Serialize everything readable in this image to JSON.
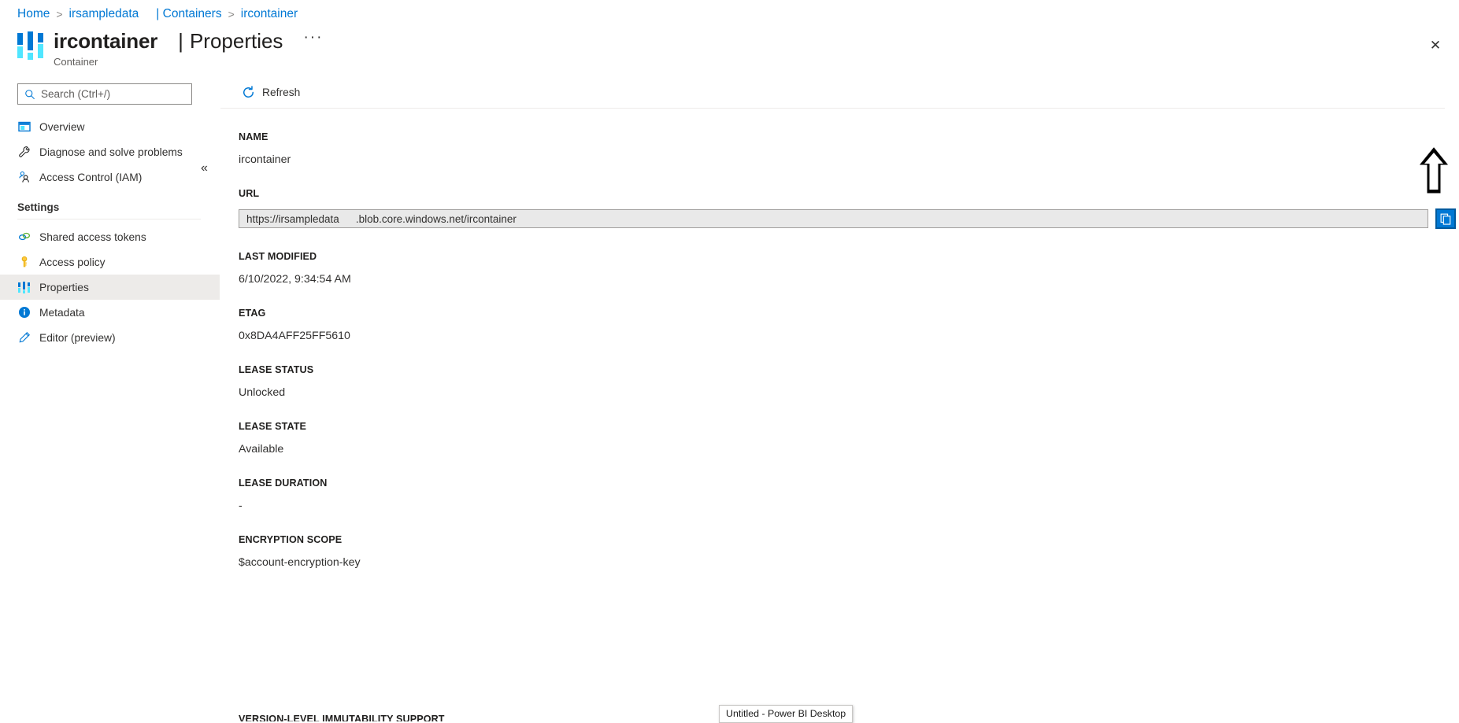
{
  "breadcrumb": {
    "items": [
      {
        "label": "Home"
      },
      {
        "label": "irsampledata"
      },
      {
        "label": "| Containers"
      },
      {
        "label": "ircontainer"
      }
    ],
    "separator": ">"
  },
  "header": {
    "icon": "container-properties-icon",
    "name": "ircontainer",
    "divider": "|",
    "section": "Properties",
    "ellipsis": "···",
    "subtitle": "Container",
    "close_label": "✕"
  },
  "sidebar": {
    "search": {
      "placeholder": "Search (Ctrl+/)",
      "value": "",
      "icon": "search-icon"
    },
    "collapse_label": "«",
    "items": [
      {
        "label": "Overview",
        "icon": "overview-icon",
        "selected": false
      },
      {
        "label": "Diagnose and solve problems",
        "icon": "wrench-icon",
        "selected": false
      },
      {
        "label": "Access Control (IAM)",
        "icon": "people-icon",
        "selected": false
      }
    ],
    "group": {
      "title": "Settings",
      "items": [
        {
          "label": "Shared access tokens",
          "icon": "link-rings-icon",
          "selected": false
        },
        {
          "label": "Access policy",
          "icon": "key-icon",
          "selected": false
        },
        {
          "label": "Properties",
          "icon": "properties-bars-icon",
          "selected": true
        },
        {
          "label": "Metadata",
          "icon": "info-icon",
          "selected": false
        },
        {
          "label": "Editor (preview)",
          "icon": "pencil-icon",
          "selected": false
        }
      ]
    }
  },
  "command_bar": {
    "refresh_label": "Refresh",
    "refresh_icon": "refresh-icon"
  },
  "properties": {
    "name": {
      "label": "NAME",
      "value": "ircontainer"
    },
    "url": {
      "label": "URL",
      "value_prefix": "https://irsampledata",
      "value_suffix": ".blob.core.windows.net/ircontainer",
      "copy_icon": "copy-icon",
      "copy_title": "Copy to clipboard"
    },
    "last_modified": {
      "label": "LAST MODIFIED",
      "value": "6/10/2022, 9:34:54 AM"
    },
    "etag": {
      "label": "ETAG",
      "value": "0x8DA4AFF25FF5610"
    },
    "lease_status": {
      "label": "LEASE STATUS",
      "value": "Unlocked"
    },
    "lease_state": {
      "label": "LEASE STATE",
      "value": "Available"
    },
    "lease_duration": {
      "label": "LEASE DURATION",
      "value": "-"
    },
    "encryption_scope": {
      "label": "ENCRYPTION SCOPE",
      "value": "$account-encryption-key"
    },
    "version_immutability": {
      "label": "VERSION-LEVEL IMMUTABILITY SUPPORT"
    }
  },
  "annotation": {
    "arrow": "up-arrow-annotation"
  },
  "taskbar": {
    "tooltip": "Untitled - Power BI Desktop"
  },
  "colors": {
    "link": "#0078d4",
    "accent": "#0078d4",
    "accent_light": "#50e6ff",
    "selected_bg": "#edebe9",
    "field_bg": "#e9e9e9",
    "text": "#323130"
  }
}
